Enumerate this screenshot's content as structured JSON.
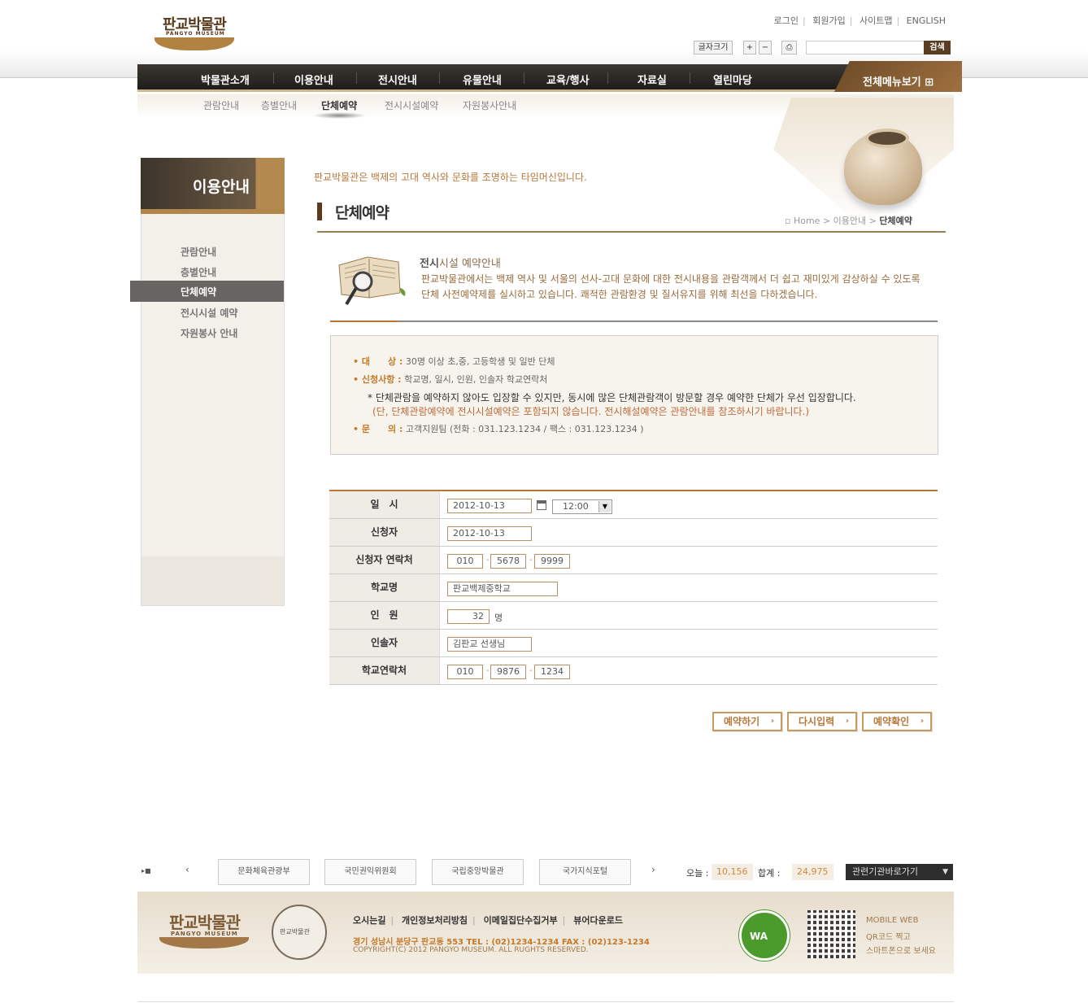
{
  "header": {
    "logo_kr": "판교박물관",
    "logo_en": "PANGYO MUSEUM",
    "util_links": [
      "로그인",
      "회원가입",
      "사이트맵",
      "ENGLISH"
    ],
    "font_size_label": "글자크기",
    "zoom_in": "+",
    "zoom_out": "−",
    "search_button": "검색"
  },
  "gnb": {
    "items": [
      "박물관소개",
      "이용안내",
      "전시안내",
      "유물안내",
      "교육/행사",
      "자료실",
      "열린마당"
    ],
    "all_menu": "전체메뉴보기"
  },
  "subnav": {
    "items": [
      "관람안내",
      "층별안내",
      "단체예약",
      "전시시설예약",
      "자원봉사안내"
    ]
  },
  "sidebar": {
    "title": "이용안내",
    "items": [
      "관람안내",
      "층별안내",
      "단체예약",
      "전시시설 예약",
      "자원봉사 안내"
    ]
  },
  "main": {
    "slogan": "판교박물관은 백제의 고대 역사와 문화를 조명하는 타임머신입니다.",
    "title": "단체예약",
    "breadcrumb": {
      "home": "Home",
      "parent": "이용안내",
      "current": "단체예약"
    },
    "intro_title_bold": "전시",
    "intro_title_rest": "시설 예약안내",
    "intro_text": "판교박물관에서는 백제 역사 및 서울의 선사-고대 문화에 대한 전시내용을 관람객께서 더 쉽고 재미있게 감상하실 수 있도록 단체 사전예약제를 실시하고 있습니다. 쾌적한 관람환경 및 질서유지를 위해 최선을 다하겠습니다.",
    "info": {
      "target_label": "대　　상 :",
      "target_value": "30명 이상 초,중, 고등학생 및 일반 단체",
      "apply_label": "신청사항 :",
      "apply_value": "학교명, 일시, 인원, 인솔자 학교연락처",
      "note1": "* 단체관람을 예약하지 않아도 입장할 수 있지만, 동시에 많은 단체관람객이 방문할 경우 예약한 단체가 우선 입장합니다.",
      "note2": "(단, 단체관람예약에 전시시설예약은 포함되지 않습니다. 전시해설예약은 관람안내를 참조하시기 바랍니다.)",
      "contact_label": "문　　의 :",
      "contact_value": "고객지원팀  (전화 : 031.123.1234 / 팩스 : 031.123.1234 )"
    },
    "form": {
      "date_label": "일　시",
      "date_value": "2012-10-13",
      "time_value": "12:00",
      "applicant_label": "신청자",
      "applicant_value": "2012-10-13",
      "phone_label": "신청자 연락처",
      "phone": [
        "010",
        "5678",
        "9999"
      ],
      "school_label": "학교명",
      "school_value": "판교백제중학교",
      "count_label": "인　원",
      "count_value": "32",
      "count_unit": "명",
      "leader_label": "인솔자",
      "leader_value": "김판교 선생님",
      "school_phone_label": "학교연락처",
      "school_phone": [
        "010",
        "9876",
        "1234"
      ]
    },
    "buttons": {
      "reserve": "예약하기",
      "reset": "다시입력",
      "check": "예약확인"
    }
  },
  "banners": {
    "items": [
      "문화체육관광부",
      "국민권익위원회",
      "국립중앙박물관",
      "국가지식포털"
    ],
    "today_label": "오늘 :",
    "today_value": "10,156",
    "total_label": "합계 :",
    "total_value": "24,975",
    "related": "관련기관바로가기"
  },
  "footer": {
    "logo_kr": "판교박물관",
    "logo_en": "PANGYO MUSEUM",
    "seal_text": "판교박물관",
    "links": [
      "오시는길",
      "개인정보처리방침",
      "이메일집단수집거부",
      "뷰어다운로드"
    ],
    "address": "경기 성남시 분당구 판교동 553   TEL : (02)1234-1234   FAX : (02)123-1234",
    "copyright": "COPYRIGHT(C) 2012 PANGYO MUSEUM. ALL RUGHTS RESERVED.",
    "wa_mark": "WA",
    "mobile": [
      "MOBILE WEB",
      "QR코드 찍고",
      "스마트폰으로 보세요"
    ]
  }
}
